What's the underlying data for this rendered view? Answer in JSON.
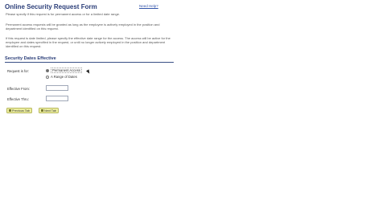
{
  "header": {
    "title": "Online Security Request Form",
    "help_link": "Need Help?"
  },
  "intro": {
    "p1": "Please specify if this request is for permanent access or for a limited date range.",
    "p2": "Permanent access requests will be granted as long as the employee is actively employed in the position and department identified on this request.",
    "p3": "If this request is date limited, please specify the effective date range for the access. The access will be active for the employee and dates specified in the request, or until no longer actively employed in the position and department identified on this request."
  },
  "section": {
    "title": "Security Dates Effective",
    "request_label": "Request is for:",
    "options": [
      {
        "label": "Permanent Access",
        "selected": true
      },
      {
        "label": "A Range of Dates",
        "selected": false
      }
    ],
    "effective_from_label": "Effective From:",
    "effective_from_value": "",
    "effective_thru_label": "Effective Thru:",
    "effective_thru_value": ""
  },
  "buttons": {
    "previous": "Previous Tab",
    "next": "Next Tab"
  },
  "colors": {
    "heading": "#2a3d78",
    "button_bg": "#eef0a0"
  }
}
